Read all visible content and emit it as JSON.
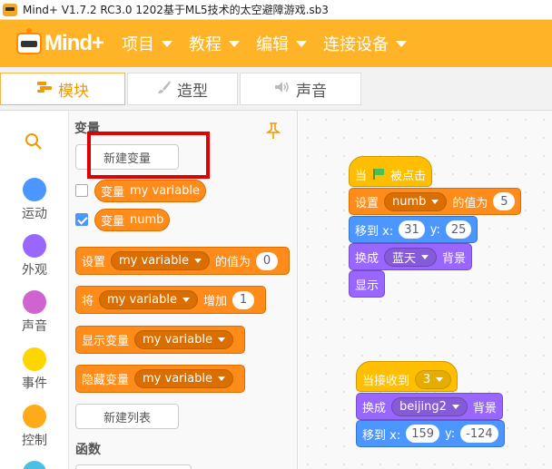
{
  "window": {
    "title": "Mind+ V1.7.2 RC3.0    1202基于ML5技术的太空避障游戏.sb3"
  },
  "menubar": {
    "logo_text": "Mind+",
    "items": [
      "项目",
      "教程",
      "编辑",
      "连接设备"
    ]
  },
  "tabs": [
    {
      "label": "模块",
      "icon": "blocks-icon",
      "active": true
    },
    {
      "label": "造型",
      "icon": "brush-icon",
      "active": false
    },
    {
      "label": "声音",
      "icon": "speaker-icon",
      "active": false
    }
  ],
  "categories": [
    {
      "label": "运动",
      "color": "#4c97ff"
    },
    {
      "label": "外观",
      "color": "#9966ff"
    },
    {
      "label": "声音",
      "color": "#cf63cf"
    },
    {
      "label": "事件",
      "color": "#ffd500"
    },
    {
      "label": "控制",
      "color": "#ffab19"
    }
  ],
  "palette": {
    "section_variables": "变量",
    "new_variable_button": "新建变量",
    "var1_label": "变量",
    "var1_name": "my variable",
    "var1_checked": false,
    "var2_label": "变量",
    "var2_name": "numb",
    "var2_checked": true,
    "set_block": {
      "prefix": "设置",
      "var": "my variable",
      "middle": "的值为",
      "value": "0"
    },
    "change_block": {
      "prefix": "将",
      "var": "my variable",
      "middle": "增加",
      "value": "1"
    },
    "show_block": {
      "prefix": "显示变量",
      "var": "my variable"
    },
    "hide_block": {
      "prefix": "隐藏变量",
      "var": "my variable"
    },
    "new_list_button": "新建列表",
    "section_functions": "函数"
  },
  "workspace": {
    "script1": {
      "hat_prefix": "当",
      "hat_suffix": "被点击",
      "set_prefix": "设置",
      "set_var": "numb",
      "set_middle": "的值为",
      "set_value": "5",
      "goto_prefix": "移到 x:",
      "goto_x": "31",
      "goto_ylabel": "y:",
      "goto_y": "25",
      "switch_prefix": "换成",
      "switch_value": "蓝天",
      "switch_suffix": "背景",
      "show_label": "显示"
    },
    "script2": {
      "hat_prefix": "当接收到",
      "hat_value": "3",
      "switch_prefix": "换成",
      "switch_value": "beijing2",
      "switch_suffix": "背景",
      "goto_prefix": "移到 x:",
      "goto_x": "159",
      "goto_ylabel": "y:",
      "goto_y": "-124"
    }
  }
}
